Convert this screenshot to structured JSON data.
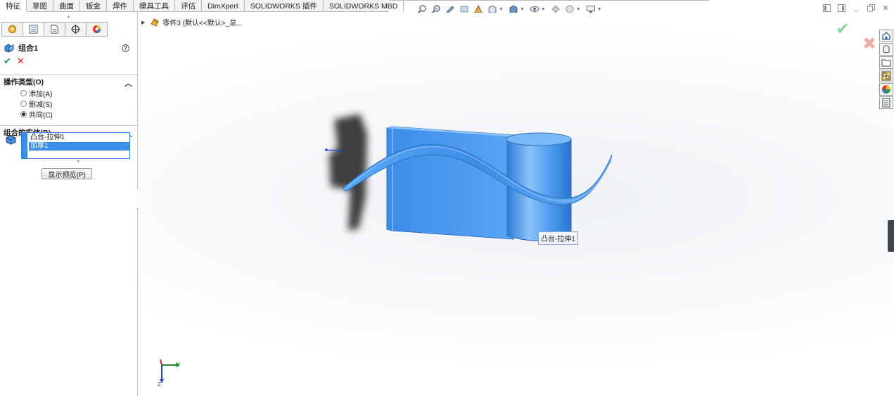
{
  "command_manager": {
    "tabs": [
      "特征",
      "草图",
      "曲面",
      "钣金",
      "焊件",
      "模具工具",
      "评估",
      "DimXpert",
      "SOLIDWORKS 插件",
      "SOLIDWORKS MBD"
    ],
    "active_tab": "特征"
  },
  "heads_up_toolbar": {
    "icons": [
      "zoom-to-fit-icon",
      "zoom-to-area-icon",
      "previous-view-icon",
      "section-view-icon",
      "dynamic-annotation-icon",
      "view-orientation-icon",
      "display-style-icon",
      "hide-show-items-icon",
      "edit-appearance-icon",
      "apply-scene-icon",
      "view-settings-icon"
    ]
  },
  "property_manager": {
    "title": "组合1",
    "operation_group": {
      "title": "操作类型(O)",
      "options": [
        {
          "label": "添加(A)",
          "selected": false
        },
        {
          "label": "删减(S)",
          "selected": false
        },
        {
          "label": "共同(C)",
          "selected": true
        }
      ]
    },
    "bodies_group": {
      "title": "组合的实体(B)",
      "bodies": [
        {
          "label": "凸台-拉伸1",
          "selected": false
        },
        {
          "label": "加厚1",
          "selected": true
        }
      ]
    },
    "preview_button": "显示预览(P)"
  },
  "feature_tree": {
    "root": "零件3  (默认<<默认>_显..."
  },
  "viewport": {
    "tooltip": "凸台-拉伸1",
    "model_color": "#4a9cf0",
    "triad": {
      "x_label": "Y",
      "y_label": "Z"
    }
  },
  "task_pane": [
    "home-icon",
    "design-library-icon",
    "file-explorer-icon",
    "view-palette-icon",
    "appearances-icon",
    "custom-properties-icon"
  ]
}
